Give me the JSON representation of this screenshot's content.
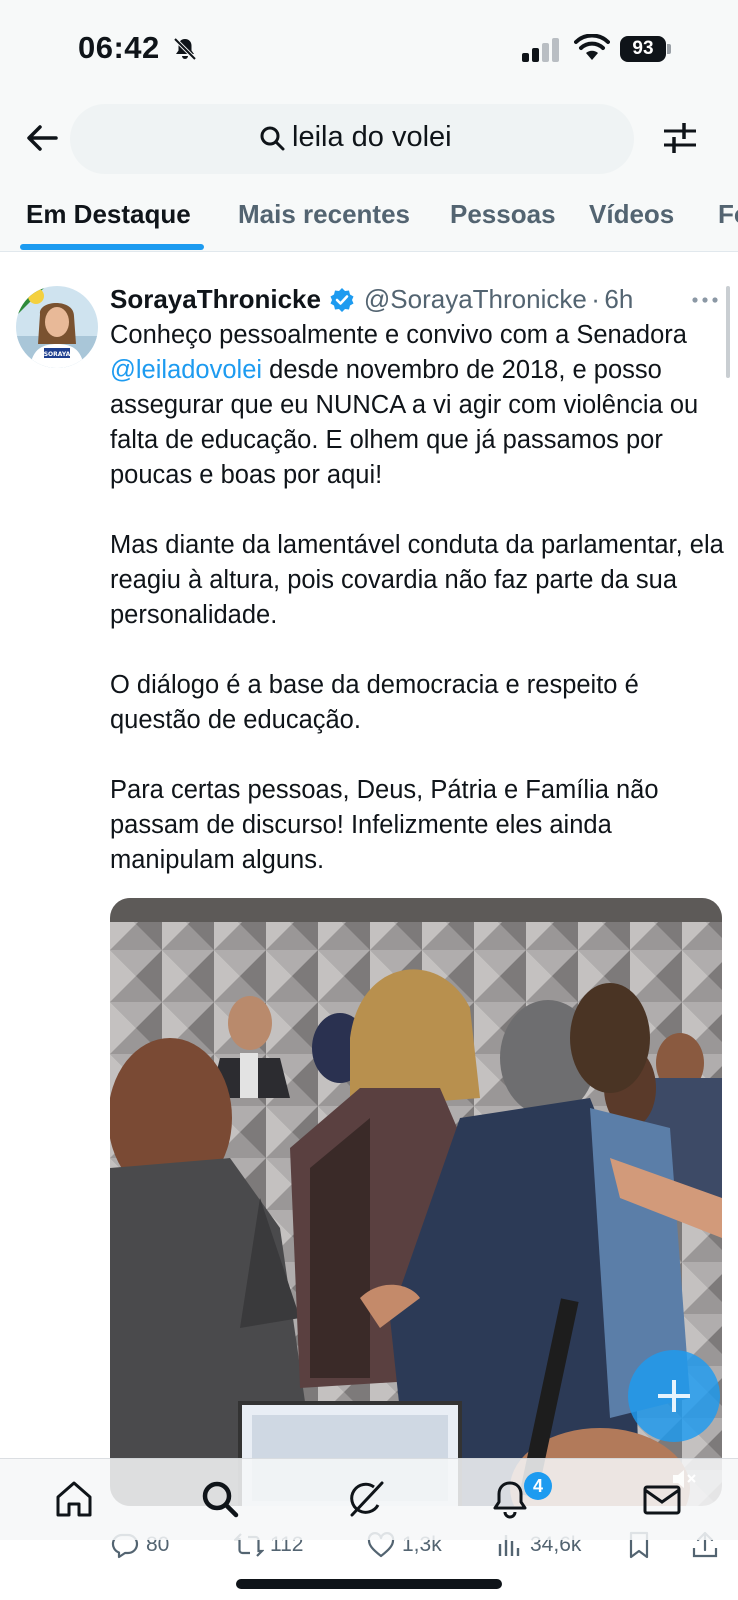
{
  "status_bar": {
    "time": "06:42",
    "battery": "93"
  },
  "search": {
    "query": "leila do volei"
  },
  "tabs": [
    {
      "label": "Em Destaque",
      "active": true
    },
    {
      "label": "Mais recentes",
      "active": false
    },
    {
      "label": "Pessoas",
      "active": false
    },
    {
      "label": "Vídeos",
      "active": false
    },
    {
      "label": "Fo",
      "active": false
    }
  ],
  "tweet": {
    "display_name": "SorayaThronicke",
    "handle": "@SorayaThronicke",
    "separator": "·",
    "time_ago": "6h",
    "avatar_badge": "SORAYA",
    "p1_before": "Conheço pessoalmente e convivo com a Senadora ",
    "mention": "@leiladovolei",
    "p1_after": " desde novembro de 2018, e posso assegurar que eu NUNCA a vi agir com violência ou falta de educação. E olhem que já passamos por poucas e boas por aqui!",
    "p2": "Mas diante da lamentável conduta da parlamentar, ela reagiu à altura, pois covardia não faz parte da sua personalidade.",
    "p3": "O diálogo é a base da democracia e respeito é questão de educação.",
    "p4": "Para certas pessoas, Deus, Pátria e Família não passam de discurso! Infelizmente eles ainda manipulam alguns.",
    "stats": {
      "replies": "80",
      "retweets": "112",
      "likes": "1,3k",
      "views": "34,6k"
    }
  },
  "bottom_nav": {
    "notifications_badge": "4"
  },
  "colors": {
    "accent": "#1d9bf0",
    "text": "#0f1419",
    "muted": "#536471"
  },
  "icons": [
    "back-arrow-icon",
    "search-icon",
    "filter-icon",
    "verified-badge-icon",
    "more-icon",
    "home-icon",
    "grok-icon",
    "bell-icon",
    "mail-icon",
    "reply-icon",
    "retweet-icon",
    "like-icon",
    "views-icon",
    "bookmark-icon",
    "share-icon",
    "mute-icon",
    "plus-icon"
  ]
}
